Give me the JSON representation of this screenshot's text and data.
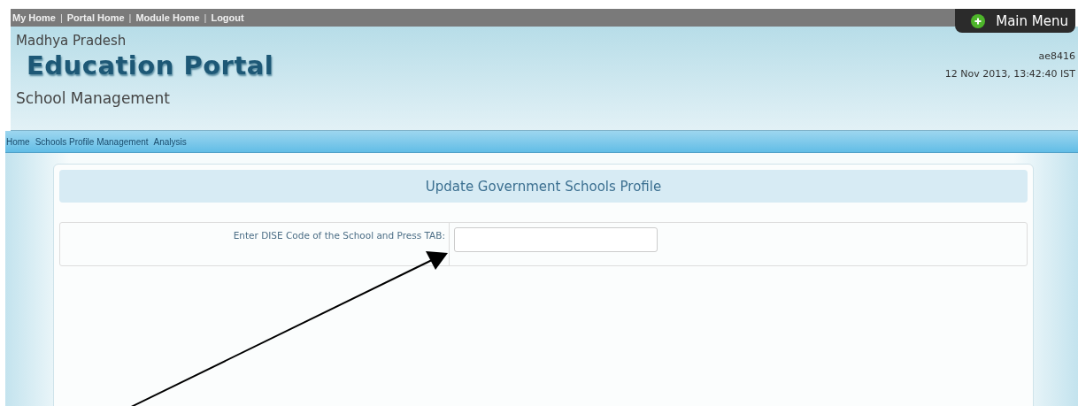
{
  "top_links": [
    "My Home",
    "Portal Home",
    "Module Home",
    "Logout"
  ],
  "separator": "|",
  "main_menu": {
    "label": "Main Menu"
  },
  "header": {
    "state": "Madhya Pradesh",
    "portal": "Education Portal",
    "module": "School Management",
    "user": "ae8416",
    "datetime": "12 Nov 2013, 13:42:40 IST"
  },
  "nav": [
    "Home",
    "Schools Profile Management",
    "Analysis"
  ],
  "panel": {
    "title": "Update Government Schools Profile",
    "field_label": "Enter DISE Code of the School and Press TAB:"
  }
}
